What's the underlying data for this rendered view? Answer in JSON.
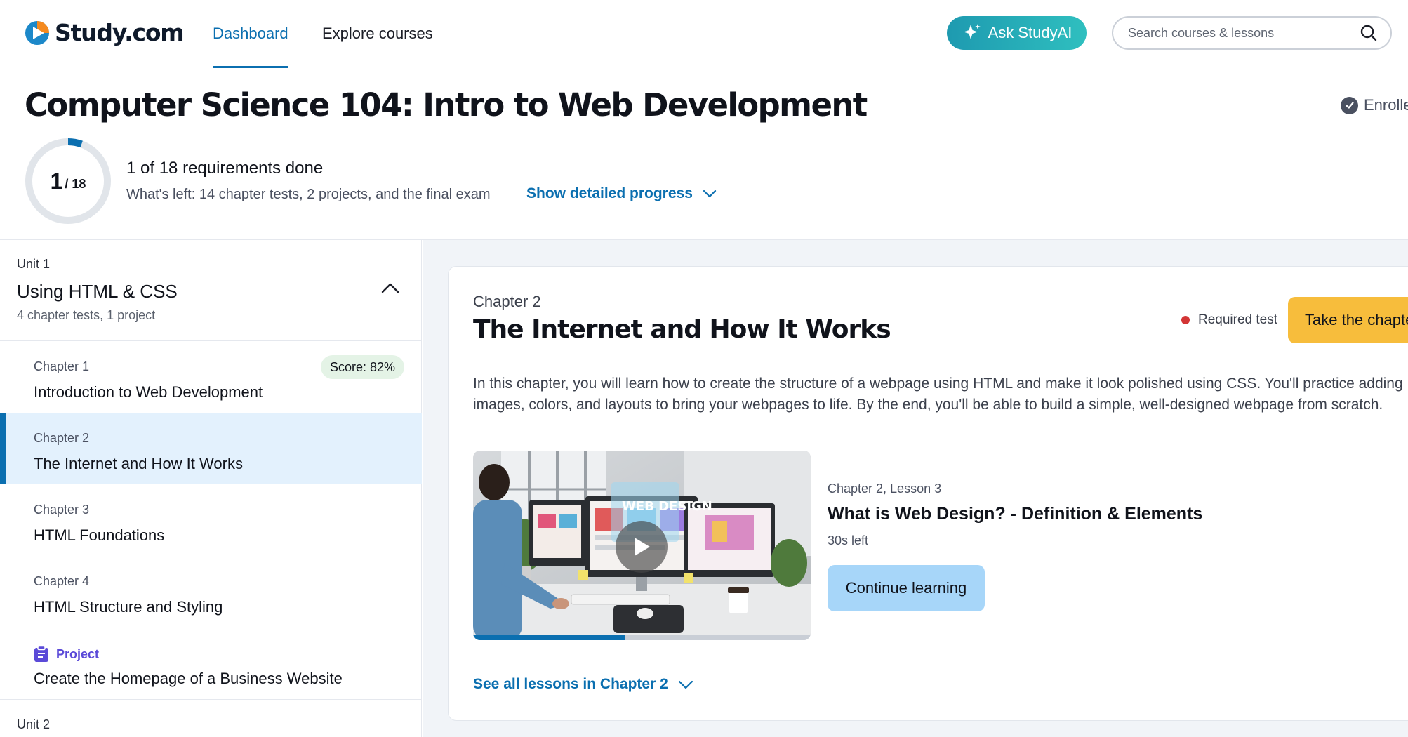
{
  "header": {
    "logo_text": "Study.com",
    "nav": [
      {
        "label": "Dashboard",
        "active": true
      },
      {
        "label": "Explore courses",
        "active": false
      }
    ],
    "ask_button": "Ask StudyAI",
    "search_placeholder": "Search courses & lessons"
  },
  "course": {
    "title": "Computer Science 104: Intro to Web Development",
    "enrolled_label": "Enrolled",
    "progress": {
      "done": "1",
      "total_label": "/ 18",
      "done_count": 1,
      "total_count": 18,
      "summary": "1 of 18 requirements done",
      "remaining": "What's left: 14 chapter tests, 2 projects, and the final exam",
      "detail_link": "Show detailed progress"
    }
  },
  "sidebar": {
    "unit1": {
      "label": "Unit 1",
      "title": "Using HTML & CSS",
      "meta": "4 chapter tests, 1 project"
    },
    "chapters": [
      {
        "kind": "Chapter 1",
        "name": "Introduction to Web Development",
        "score": "Score: 82%"
      },
      {
        "kind": "Chapter 2",
        "name": "The Internet and How It Works",
        "active": true
      },
      {
        "kind": "Chapter 3",
        "name": "HTML Foundations"
      },
      {
        "kind": "Chapter 4",
        "name": "HTML Structure and Styling"
      },
      {
        "kind": "Project",
        "name": "Create the Homepage of a Business Website",
        "project": true
      }
    ],
    "unit2": {
      "label": "Unit 2"
    }
  },
  "main": {
    "chapter_label": "Chapter 2",
    "chapter_title": "The Internet and How It Works",
    "required_label": "Required test",
    "take_button": "Take the chapter test",
    "description": "In this chapter, you will learn how to create the structure of a webpage using HTML and make it look polished using CSS. You'll practice adding images, colors, and layouts to bring your webpages to life. By the end, you'll be able to build a simple, well-designed webpage from scratch.",
    "lesson": {
      "meta": "Chapter 2, Lesson 3",
      "title": "What is Web Design? - Definition & Elements",
      "time_left": "30s left",
      "video_progress": 0.45,
      "thumbnail_screen_text": "WEB DESIGN",
      "continue_button": "Continue learning"
    },
    "see_all": "See all lessons in Chapter 2"
  },
  "colors": {
    "accent": "#0b6fb0",
    "take_button": "#f7bd3c",
    "continue_button": "#a7d6f9",
    "active_chapter_bg": "#e3f1fd",
    "score_badge_bg": "#e4f3e6",
    "required_dot": "#d33535",
    "project_color": "#5b4ad8"
  }
}
